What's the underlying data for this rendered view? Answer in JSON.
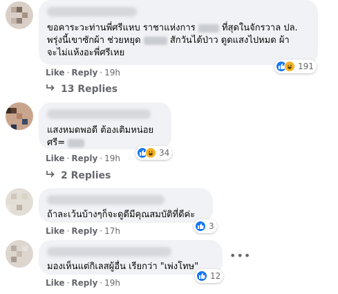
{
  "comments": [
    {
      "lines": [
        "ขอคาระวะท่านพี่ศรีแหบ ราชาแห่งการ",
        "ที่สุดในจักรวาล ปล.",
        "พรุ่งนี้เขาซักผ้า ช่วยหยุด",
        "สักวันได้ป่าว ดูดแสงไปหมด ผ้า",
        "จะไม่แห้งอะพี่ศรีเหย"
      ],
      "like": "Like",
      "reply": "Reply",
      "time": "19h",
      "reaction_count": "191",
      "replies": "13 Replies"
    },
    {
      "lines": [
        "แสงหมดพอดี ต้องเติมหน่อย",
        "ศรี="
      ],
      "like": "Like",
      "reply": "Reply",
      "time": "19h",
      "reaction_count": "34",
      "replies": "2 Replies"
    },
    {
      "lines": [
        "ถ้าละเว้นบ้างๆก็จะดูดีมีคุณสมบัติที่ดีค่ะ"
      ],
      "like": "Like",
      "reply": "Reply",
      "time": "17h",
      "reaction_count": "3"
    },
    {
      "lines": [
        "มองเห็นแต่กิเลสผู้อื่น เรียกว่า \"เพ่งโทษ\""
      ],
      "like": "Like",
      "reply": "Reply",
      "time": "19h",
      "reaction_count": "12"
    }
  ],
  "colors": {
    "bubble": "#f0f2f5",
    "meta": "#65676b",
    "like_blue": "#1877f2",
    "haha_yellow": "#f7b125"
  },
  "icons": [
    "like-reaction-icon",
    "haha-reaction-icon",
    "reply-arrow-icon",
    "more-options-icon"
  ]
}
